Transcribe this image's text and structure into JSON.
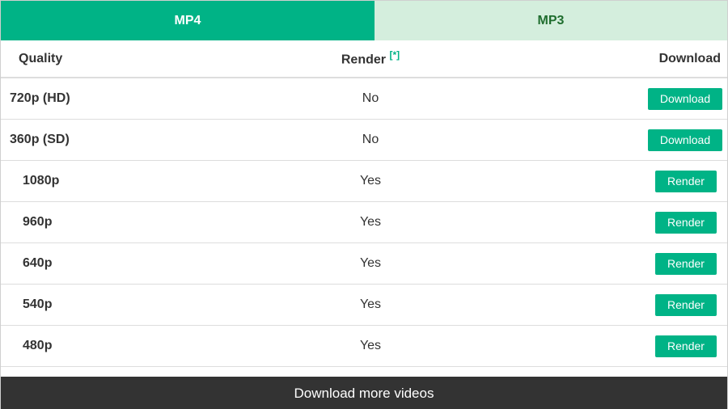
{
  "tabs": [
    {
      "label": "MP4",
      "active": true
    },
    {
      "label": "MP3",
      "active": false
    }
  ],
  "table": {
    "headers": {
      "quality": "Quality",
      "render": "Render",
      "render_note": "[*]",
      "download": "Download"
    },
    "rows": [
      {
        "quality": "720p (HD)",
        "render": "No",
        "action": "Download"
      },
      {
        "quality": "360p (SD)",
        "render": "No",
        "action": "Download"
      },
      {
        "quality": "1080p",
        "render": "Yes",
        "action": "Render"
      },
      {
        "quality": "960p",
        "render": "Yes",
        "action": "Render"
      },
      {
        "quality": "640p",
        "render": "Yes",
        "action": "Render"
      },
      {
        "quality": "540p",
        "render": "Yes",
        "action": "Render"
      },
      {
        "quality": "480p",
        "render": "Yes",
        "action": "Render"
      }
    ]
  },
  "footer": {
    "label": "Download more videos"
  },
  "colors": {
    "accent": "#00b386",
    "tab_inactive_bg": "#d4eedd",
    "tab_inactive_text": "#1f6d2e",
    "footer_bg": "#333333"
  }
}
